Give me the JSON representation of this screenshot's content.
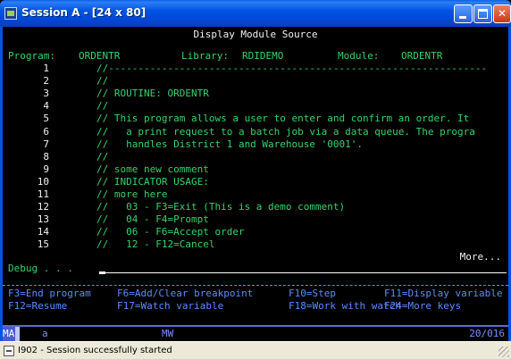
{
  "window": {
    "title": "Session A - [24 x 80]",
    "min_glyph": "minimize",
    "max_glyph": "maximize",
    "close_glyph": "✕"
  },
  "screen": {
    "title": "Display Module Source",
    "program_label": "Program:",
    "program_value": "ORDENTR",
    "library_label": "Library:",
    "library_value": "RDIDEMO",
    "module_label": "Module:",
    "module_value": "ORDENTR",
    "source_lines": [
      {
        "num": "1",
        "text": "//----------------------------------------------------------------"
      },
      {
        "num": "2",
        "text": "//"
      },
      {
        "num": "3",
        "text": "// ROUTINE: ORDENTR"
      },
      {
        "num": "4",
        "text": "//"
      },
      {
        "num": "5",
        "text": "// This program allows a user to enter and confirm an order. It"
      },
      {
        "num": "6",
        "text": "//   a print request to a batch job via a data queue. The progra"
      },
      {
        "num": "7",
        "text": "//   handles District 1 and Warehouse '0001'."
      },
      {
        "num": "8",
        "text": "//"
      },
      {
        "num": "9",
        "text": "// some new comment"
      },
      {
        "num": "10",
        "text": "// INDICATOR USAGE:"
      },
      {
        "num": "11",
        "text": "// more here"
      },
      {
        "num": "12",
        "text": "//   03 - F3=Exit (This is a demo comment)"
      },
      {
        "num": "13",
        "text": "//   04 - F4=Prompt"
      },
      {
        "num": "14",
        "text": "//   06 - F6=Accept order"
      },
      {
        "num": "15",
        "text": "//   12 - F12=Cancel"
      }
    ],
    "more": "More...",
    "debug_label": "Debug . . .",
    "fkeys_row1": [
      {
        "text": "F3=End program",
        "col": 0
      },
      {
        "text": "F6=Add/Clear breakpoint",
        "col": 1
      },
      {
        "text": "F10=Step",
        "col": 2
      },
      {
        "text": "F11=Display variable",
        "col": 3
      }
    ],
    "fkeys_row2": [
      {
        "text": "F12=Resume",
        "col": 0
      },
      {
        "text": "F17=Watch variable",
        "col": 1
      },
      {
        "text": "F18=Work with watch",
        "col": 2
      },
      {
        "text": "F24=More keys",
        "col": 3
      }
    ]
  },
  "oia": {
    "ma": "MA",
    "session": "a",
    "mw": "MW",
    "position": "20/016"
  },
  "status": {
    "text": "I902 - Session successfully started"
  }
}
